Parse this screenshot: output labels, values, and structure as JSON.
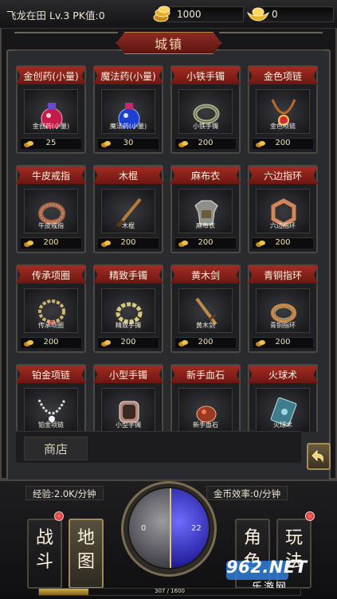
{
  "player": {
    "info": "飞龙在田  Lv.3 PK值:0"
  },
  "resources": {
    "gold": "1000",
    "ingot": "0"
  },
  "panel_title": "城镇",
  "items": [
    {
      "name": "金创药(小量)",
      "caption": "金创药(小量)",
      "price": "25",
      "icon": "red-potion-icon"
    },
    {
      "name": "魔法药(小量)",
      "caption": "魔法药(小量)",
      "price": "30",
      "icon": "blue-potion-icon"
    },
    {
      "name": "小铁手镯",
      "caption": "小铁手镯",
      "price": "200",
      "icon": "iron-bracelet-icon"
    },
    {
      "name": "金色项链",
      "caption": "金色项链",
      "price": "200",
      "icon": "gold-necklace-icon"
    },
    {
      "name": "牛皮戒指",
      "caption": "牛皮戒指",
      "price": "200",
      "icon": "leather-ring-icon"
    },
    {
      "name": "木棍",
      "caption": "木棍",
      "price": "200",
      "icon": "wooden-stick-icon"
    },
    {
      "name": "麻布衣",
      "caption": "麻布衣",
      "price": "200",
      "icon": "linen-armor-icon"
    },
    {
      "name": "六边指环",
      "caption": "六边指环",
      "price": "200",
      "icon": "hexagon-ring-icon"
    },
    {
      "name": "传承项圈",
      "caption": "传承项圈",
      "price": "200",
      "icon": "heritage-collar-icon"
    },
    {
      "name": "精致手镯",
      "caption": "精致手镯",
      "price": "200",
      "icon": "fine-bracelet-icon"
    },
    {
      "name": "黄木剑",
      "caption": "黄木剑",
      "price": "200",
      "icon": "wooden-sword-icon"
    },
    {
      "name": "青铜指环",
      "caption": "青铜指环",
      "price": "200",
      "icon": "bronze-ring-icon"
    },
    {
      "name": "铂金项链",
      "caption": "铂金项链",
      "price": "",
      "icon": "platinum-necklace-icon"
    },
    {
      "name": "小型手镯",
      "caption": "小型手镯",
      "price": "",
      "icon": "small-bracelet-icon"
    },
    {
      "name": "新手血石",
      "caption": "新手血石",
      "price": "",
      "icon": "blood-stone-icon"
    },
    {
      "name": "火球术",
      "caption": "火球术",
      "price": "",
      "icon": "fireball-book-icon"
    }
  ],
  "shop_label": "商店",
  "stats": {
    "exp": "经验:2.0K/分钟",
    "coin_rate": "金币效率:0/分钟"
  },
  "tabs": [
    {
      "label": "战\n斗",
      "active": false
    },
    {
      "label": "地\n图",
      "active": true
    },
    {
      "label": "角\n色",
      "active": false
    },
    {
      "label": "玩\n法",
      "active": false
    }
  ],
  "orb": {
    "left_value": "0",
    "right_value": "22"
  },
  "xp": {
    "text": "307 / 1600",
    "fraction": 0.19
  },
  "watermark": {
    "main": "962.NET",
    "sub": "乐游网"
  },
  "colors": {
    "ribbon": "#a12b22",
    "accent_gold": "#d4b046",
    "mana": "#1a1690"
  }
}
